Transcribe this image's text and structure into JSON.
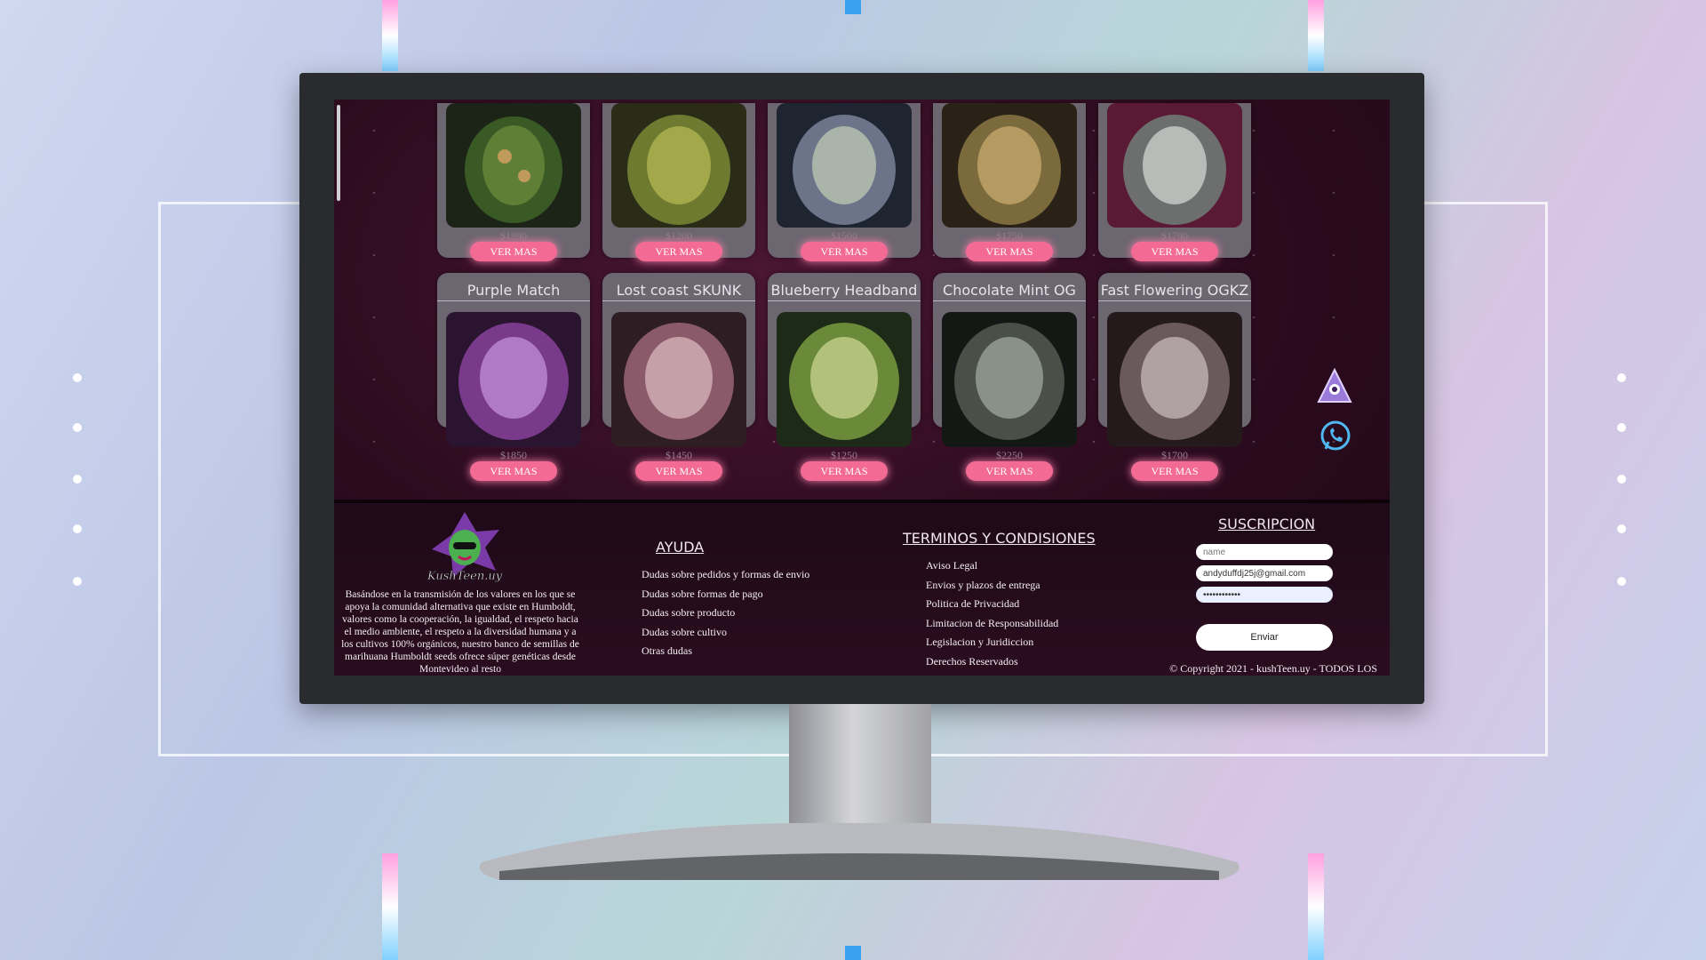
{
  "page": {
    "accent_color": "#f36b95",
    "background": "#2c0b1f"
  },
  "products": {
    "row1": [
      {
        "price": "$1990",
        "button": "VER MAS",
        "tone": "#3a5a25"
      },
      {
        "price": "$1200",
        "button": "VER MAS",
        "tone": "#6d7a30"
      },
      {
        "price": "$1500",
        "button": "VER MAS",
        "tone": "#6b7489"
      },
      {
        "price": "$1750",
        "button": "VER MAS",
        "tone": "#7a6a3c"
      },
      {
        "price": "$1790",
        "button": "VER MAS",
        "tone": "#6c6f6e"
      }
    ],
    "row2": [
      {
        "name": "Purple Match",
        "price": "$1850",
        "button": "VER MAS",
        "tone": "#7a3a8c"
      },
      {
        "name": "Lost coast SKUNK",
        "price": "$1450",
        "button": "VER MAS",
        "tone": "#8a5a6a"
      },
      {
        "name": "Blueberry Headband",
        "price": "$1250",
        "button": "VER MAS",
        "tone": "#6a8a3a"
      },
      {
        "name": "Chocolate Mint OG",
        "price": "$2250",
        "button": "VER MAS",
        "tone": "#4a5048"
      },
      {
        "name": "Fast Flowering OGKZ",
        "price": "$1700",
        "button": "VER MAS",
        "tone": "#6a5a5e"
      }
    ]
  },
  "floating": {
    "alien_icon": "alien-icon",
    "whatsapp_icon": "whatsapp-icon"
  },
  "footer": {
    "logo_text": "KushTeen.uy",
    "description": "Basándose en la transmisión de los valores en los que se apoya la comunidad alternativa que existe en Humboldt, valores como la cooperación, la igualdad, el respeto hacia el medio ambiente, el respeto a la diversidad humana y a los cultivos 100% orgánicos, nuestro banco de semillas de marihuana Humboldt seeds ofrece súper genéticas desde Montevideo al resto",
    "help": {
      "title": "AYUDA",
      "links": [
        "Dudas sobre pedidos y formas de envio",
        "Dudas sobre formas de pago",
        "Dudas sobre producto",
        "Dudas sobre cultivo",
        "Otras dudas"
      ]
    },
    "terms": {
      "title": "TERMINOS Y CONDISIONES",
      "links": [
        "Aviso Legal",
        "Envios y plazos de entrega",
        "Politica de Privacidad",
        "Limitacion de Responsabilidad",
        "Legislacion y Juridiccion",
        "Derechos Reservados"
      ]
    },
    "subscription": {
      "title": "SUSCRIPCION",
      "name_placeholder": "name",
      "email_value": "andyduffdj25j@gmail.com",
      "password_value": "••••••••••••",
      "send_label": "Enviar"
    },
    "copyright": "© Copyright 2021 - kushTeen.uy - TODOS LOS"
  }
}
